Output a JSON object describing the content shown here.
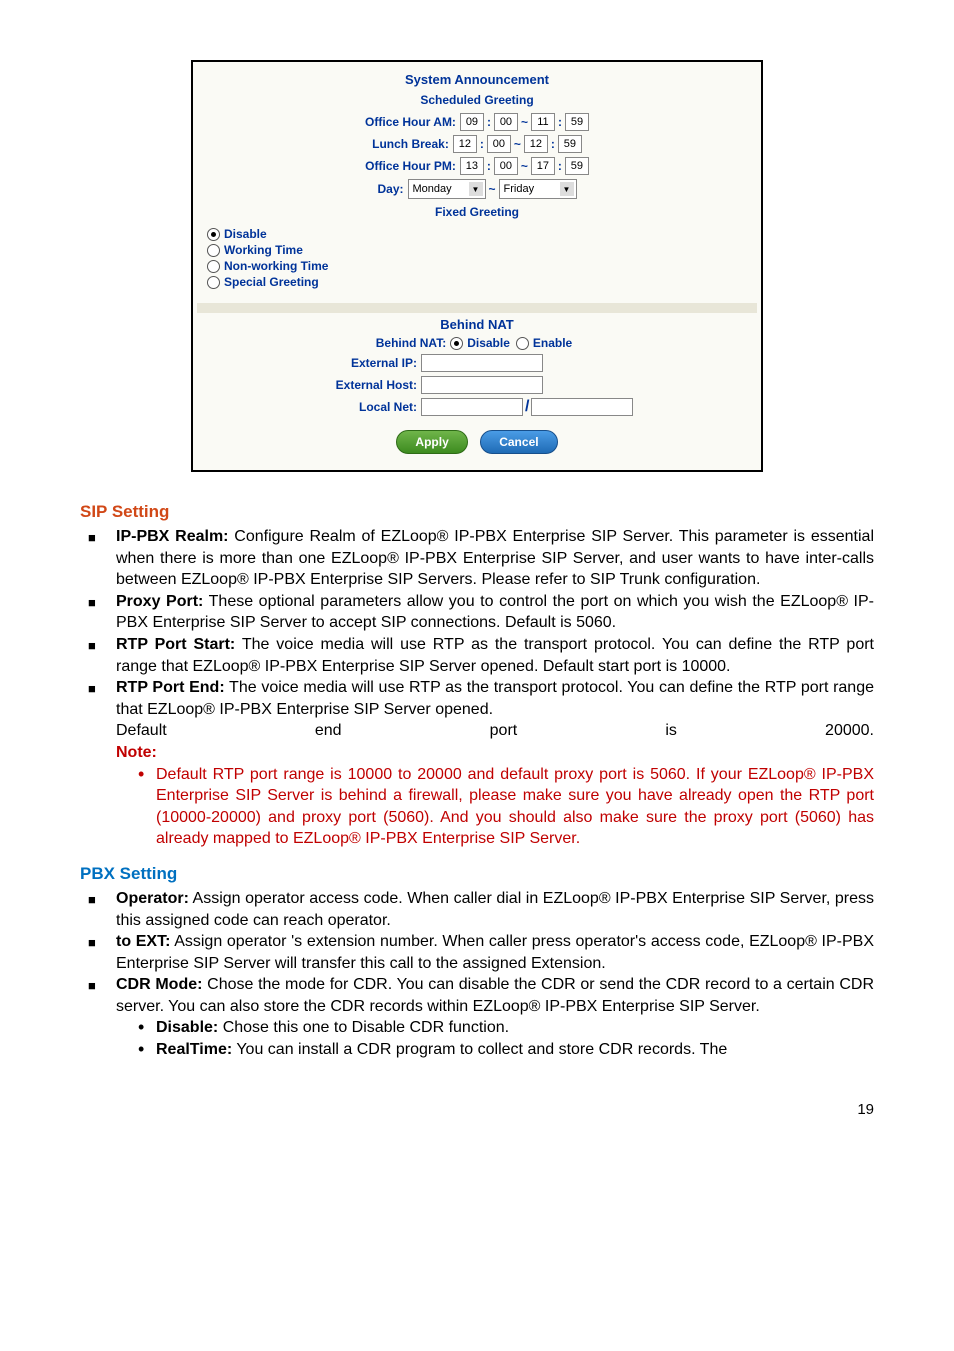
{
  "screenshot": {
    "system_announcement": "System Announcement",
    "scheduled_greeting": "Scheduled Greeting",
    "office_am_label": "Office Hour AM:",
    "office_am": {
      "h1": "09",
      "m1": "00",
      "h2": "11",
      "m2": "59"
    },
    "lunch_label": "Lunch Break:",
    "lunch": {
      "h1": "12",
      "m1": "00",
      "h2": "12",
      "m2": "59"
    },
    "office_pm_label": "Office Hour PM:",
    "office_pm": {
      "h1": "13",
      "m1": "00",
      "h2": "17",
      "m2": "59"
    },
    "day_label": "Day:",
    "day_from": "Monday",
    "day_to": "Friday",
    "fixed_greeting": "Fixed Greeting",
    "opt_disable": "Disable",
    "opt_working": "Working Time",
    "opt_nonworking": "Non-working Time",
    "opt_special": "Special Greeting",
    "behind_nat_title": "Behind NAT",
    "behind_nat_label": "Behind NAT:",
    "nat_disable": "Disable",
    "nat_enable": "Enable",
    "ext_ip": "External IP:",
    "ext_host": "External Host:",
    "local_net": "Local Net:",
    "btn_apply": "Apply",
    "btn_cancel": "Cancel",
    "colon": ":",
    "tilde": "~",
    "slash": "/"
  },
  "sip_heading": "SIP Setting",
  "sip": {
    "realm_label": "IP-PBX Realm:",
    "realm_text": " Configure Realm of EZLoop® IP-PBX Enterprise SIP Server. This parameter is essential when there is more than one EZLoop® IP-PBX Enterprise SIP Server, and user wants to have inter-calls between EZLoop® IP-PBX Enterprise SIP Servers. Please refer to SIP Trunk configuration.",
    "proxy_label": "Proxy Port:",
    "proxy_text": " These optional parameters allow you to control the port on which you wish the EZLoop® IP-PBX Enterprise SIP Server to accept SIP connections. Default is 5060.",
    "rtpstart_label": "RTP Port Start:",
    "rtpstart_text": " The voice media will use RTP as the transport protocol. You can define the RTP port range that EZLoop® IP-PBX Enterprise SIP Server opened. Default start port is 10000.",
    "rtpend_label": "RTP Port End:",
    "rtpend_text": " The voice media will use RTP as the transport protocol. You can define the RTP port range that EZLoop® IP-PBX Enterprise SIP Server opened. ",
    "rtpend_wide": {
      "w1": "Default",
      "w2": "end",
      "w3": "port",
      "w4": "is",
      "w5": "20000."
    },
    "note_label": "Note:",
    "note_text": "Default RTP port range is 10000 to 20000 and default proxy port is 5060. If your EZLoop® IP-PBX Enterprise SIP Server is behind a firewall, please make sure you have already open the RTP port (10000-20000) and proxy port (5060). And you should also make sure the proxy port (5060) has already mapped to EZLoop® IP-PBX Enterprise SIP Server."
  },
  "pbx_heading": "PBX Setting",
  "pbx": {
    "operator_label": "Operator:",
    "operator_text": " Assign operator access code. When caller dial in EZLoop® IP-PBX Enterprise SIP Server, press this assigned code can reach operator.",
    "toext_label": "to EXT:",
    "toext_text": " Assign operator 's extension number. When caller press operator's access code, EZLoop® IP-PBX Enterprise SIP Server will transfer this call to the assigned Extension.",
    "cdr_label": "CDR Mode:",
    "cdr_text": " Chose the mode for CDR. You can disable the CDR or send the CDR record to a certain CDR server. You can also store the CDR records within EZLoop® IP-PBX Enterprise SIP Server.",
    "cdr_disable_label": "Disable:",
    "cdr_disable_text": " Chose this one to Disable CDR function.",
    "cdr_realtime_label": "RealTime:",
    "cdr_realtime_text": " You can install a CDR program to collect and store CDR records. The"
  },
  "page_number": "19"
}
